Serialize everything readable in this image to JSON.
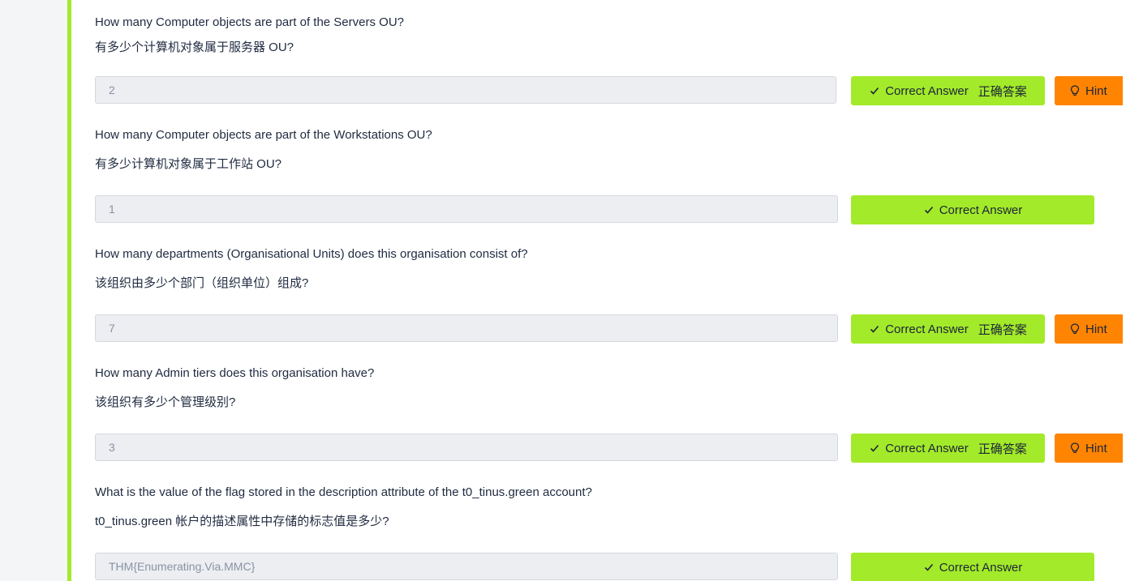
{
  "questions": [
    {
      "text_en": "How many Computer objects are part of the Servers OU?",
      "text_zh": "有多少个计算机对象属于服务器 OU?",
      "answer": "2",
      "button_label": "Correct Answer",
      "button_label_zh": "正确答案",
      "hint_label": "Hint"
    },
    {
      "text_en": "How many Computer objects are part of the Workstations OU?",
      "text_zh": "有多少计算机对象属于工作站 OU?",
      "answer": "1",
      "button_label": "Correct Answer"
    },
    {
      "text_en": "How many departments (Organisational Units) does this organisation consist of?",
      "text_zh": "该组织由多少个部门（组织单位）组成?",
      "answer": "7",
      "button_label": "Correct Answer",
      "button_label_zh": "正确答案",
      "hint_label": "Hint"
    },
    {
      "text_en": "How many Admin tiers does this organisation have?",
      "text_zh": "该组织有多少个管理级别?",
      "answer": "3",
      "button_label": "Correct Answer",
      "button_label_zh": "正确答案",
      "hint_label": "Hint"
    },
    {
      "text_en": "What is the value of the flag stored in the description attribute of the t0_tinus.green account?",
      "text_zh": "t0_tinus.green 帐户的描述属性中存储的标志值是多少?",
      "answer": "THM{Enumerating.Via.MMC}",
      "button_label": "Correct Answer"
    }
  ],
  "icons": {
    "check": "check-icon",
    "hint": "lightbulb-icon"
  },
  "colors": {
    "accent_green": "#a3ea2a",
    "hint_orange": "#ff8401",
    "input_bg": "#eceef2",
    "text": "#212c42"
  }
}
